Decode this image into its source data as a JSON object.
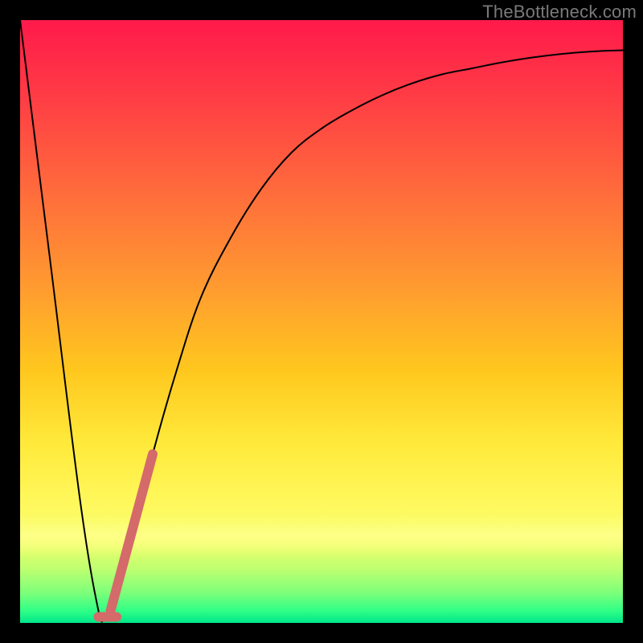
{
  "watermark": "TheBottleneck.com",
  "colors": {
    "background": "#000000",
    "gradient_top": "#ff1a4b",
    "gradient_bottom": "#00e68a",
    "curve": "#000000",
    "marker": "#d46a6a",
    "watermark_text": "#7a7a7a"
  },
  "chart_data": {
    "type": "line",
    "title": "",
    "xlabel": "",
    "ylabel": "",
    "xlim": [
      0,
      100
    ],
    "ylim": [
      0,
      100
    ],
    "grid": false,
    "legend": false,
    "series": [
      {
        "name": "bottleneck-curve",
        "x": [
          0,
          5,
          10,
          13,
          14,
          15,
          18,
          22,
          26,
          30,
          35,
          40,
          45,
          50,
          55,
          60,
          65,
          70,
          75,
          80,
          85,
          90,
          95,
          100
        ],
        "y": [
          100,
          60,
          20,
          2,
          1,
          2,
          12,
          28,
          42,
          54,
          64,
          72,
          78,
          82,
          85,
          87.5,
          89.5,
          91,
          92,
          93,
          93.8,
          94.4,
          94.8,
          95
        ],
        "color": "#000000",
        "stroke_width": 2
      },
      {
        "name": "highlight-segment",
        "x": [
          15,
          22
        ],
        "y": [
          2,
          28
        ],
        "color": "#d46a6a",
        "stroke_width": 12,
        "linecap": "round"
      },
      {
        "name": "highlight-base",
        "x": [
          13,
          16
        ],
        "y": [
          1,
          1
        ],
        "color": "#d46a6a",
        "stroke_width": 12,
        "linecap": "round"
      }
    ]
  }
}
